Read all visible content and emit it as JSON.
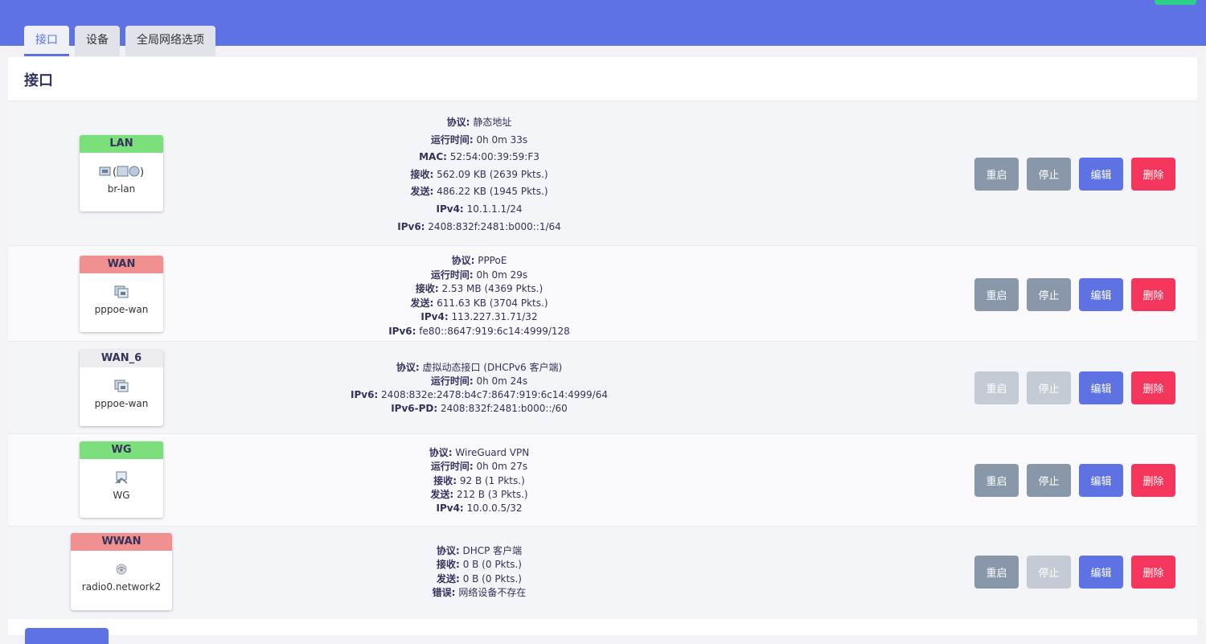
{
  "tabs": [
    {
      "label": "接口"
    },
    {
      "label": "设备"
    },
    {
      "label": "全局网络选项"
    }
  ],
  "panel_title": "接口",
  "buttons": {
    "restart": "重启",
    "stop": "停止",
    "edit": "编辑",
    "delete": "删除"
  },
  "colors": {
    "accent": "#5e72e4",
    "lan_green": "#7be07b",
    "wan_red": "#f09090",
    "neutral": "#ededf0",
    "danger": "#f5365c"
  },
  "interfaces": [
    {
      "name": "LAN",
      "device": "br-lan",
      "icon": "bridge-icon",
      "color": "#7be07b",
      "details": [
        {
          "k": "协议:",
          "v": "静态地址"
        },
        {
          "k": "运行时间:",
          "v": "0h 0m 33s"
        },
        {
          "k": "MAC:",
          "v": "52:54:00:39:59:F3"
        },
        {
          "k": "接收:",
          "v": "562.09 KB (2639 Pkts.)"
        },
        {
          "k": "发送:",
          "v": "486.22 KB (1945 Pkts.)"
        },
        {
          "k": "IPv4:",
          "v": "10.1.1.1/24"
        },
        {
          "k": "IPv6:",
          "v": "2408:832f:2481:b000::1/64"
        }
      ],
      "restart_disabled": false,
      "stop_disabled": false
    },
    {
      "name": "WAN",
      "device": "pppoe-wan",
      "icon": "ethernet-icon",
      "color": "#f09090",
      "details": [
        {
          "k": "协议:",
          "v": "PPPoE"
        },
        {
          "k": "运行时间:",
          "v": "0h 0m 29s"
        },
        {
          "k": "接收:",
          "v": "2.53 MB (4369 Pkts.)"
        },
        {
          "k": "发送:",
          "v": "611.63 KB (3704 Pkts.)"
        },
        {
          "k": "IPv4:",
          "v": "113.227.31.71/32"
        },
        {
          "k": "IPv6:",
          "v": "fe80::8647:919:6c14:4999/128"
        }
      ],
      "restart_disabled": false,
      "stop_disabled": false
    },
    {
      "name": "WAN_6",
      "device": "pppoe-wan",
      "icon": "ethernet-icon",
      "color": "#ededf0",
      "details": [
        {
          "k": "协议:",
          "v": "虚拟动态接口 (DHCPv6 客户端)"
        },
        {
          "k": "运行时间:",
          "v": "0h 0m 24s"
        },
        {
          "k": "IPv6:",
          "v": "2408:832e:2478:b4c7:8647:919:6c14:4999/64"
        },
        {
          "k": "IPv6-PD:",
          "v": "2408:832f:2481:b000::/60"
        }
      ],
      "restart_disabled": true,
      "stop_disabled": true
    },
    {
      "name": "WG",
      "device": "WG",
      "icon": "tunnel-icon",
      "color": "#7be07b",
      "details": [
        {
          "k": "协议:",
          "v": "WireGuard VPN"
        },
        {
          "k": "运行时间:",
          "v": "0h 0m 27s"
        },
        {
          "k": "接收:",
          "v": "92 B (1 Pkts.)"
        },
        {
          "k": "发送:",
          "v": "212 B (3 Pkts.)"
        },
        {
          "k": "IPv4:",
          "v": "10.0.0.5/32"
        }
      ],
      "restart_disabled": false,
      "stop_disabled": false
    },
    {
      "name": "WWAN",
      "device": "radio0.network2",
      "icon": "wifi-icon",
      "color": "#f09090",
      "details": [
        {
          "k": "协议:",
          "v": "DHCP 客户端"
        },
        {
          "k": "接收:",
          "v": "0 B (0 Pkts.)"
        },
        {
          "k": "发送:",
          "v": "0 B (0 Pkts.)"
        },
        {
          "k": "错误:",
          "v": "网络设备不存在"
        }
      ],
      "restart_disabled": false,
      "stop_disabled": true
    }
  ]
}
